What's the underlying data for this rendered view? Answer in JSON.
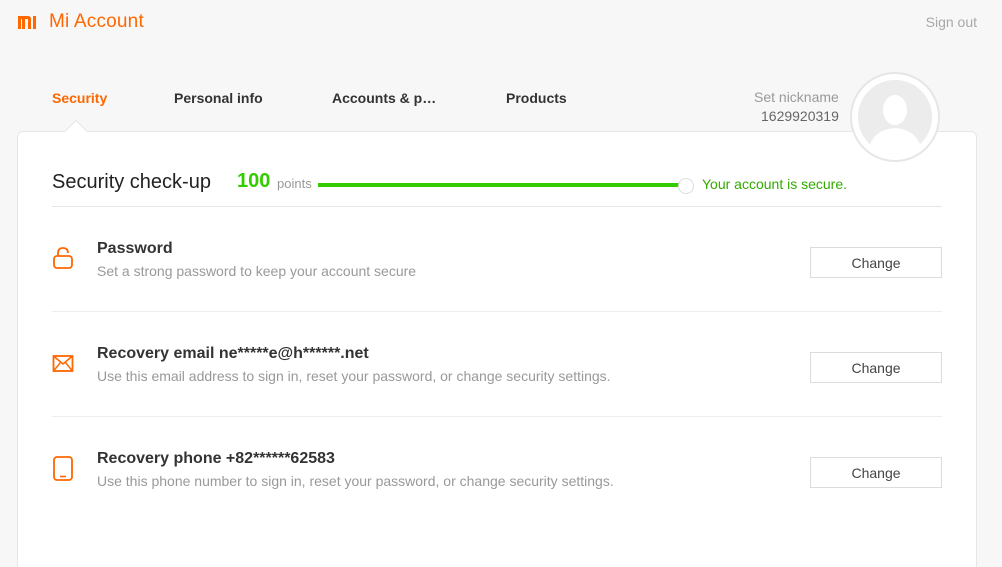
{
  "brand": {
    "title": "Mi Account",
    "accent_color": "#ff6700",
    "logo_icon": "mi-logo-icon"
  },
  "header": {
    "signout_label": "Sign out"
  },
  "tabs": [
    {
      "label": "Security",
      "active": true
    },
    {
      "label": "Personal info",
      "active": false
    },
    {
      "label": "Accounts & p…",
      "active": false
    },
    {
      "label": "Products",
      "active": false
    }
  ],
  "profile": {
    "nickname_label": "Set nickname",
    "user_id": "1629920319",
    "avatar_icon": "avatar-placeholder-icon"
  },
  "checkup": {
    "title": "Security check-up",
    "score": "100",
    "points_label": "points",
    "progress_percent": 100,
    "status_text": "Your account is secure.",
    "status_color": "#33cc00"
  },
  "items": [
    {
      "icon": "lock-icon",
      "title": "Password",
      "description": "Set a strong password to keep your account secure",
      "button_label": "Change"
    },
    {
      "icon": "envelope-icon",
      "title": "Recovery email ne*****e@h******.net",
      "description": "Use this email address to sign in, reset your password, or change security settings.",
      "button_label": "Change"
    },
    {
      "icon": "phone-icon",
      "title": "Recovery phone +82******62583",
      "description": "Use this phone number to sign in, reset your password, or change security settings.",
      "button_label": "Change"
    }
  ]
}
